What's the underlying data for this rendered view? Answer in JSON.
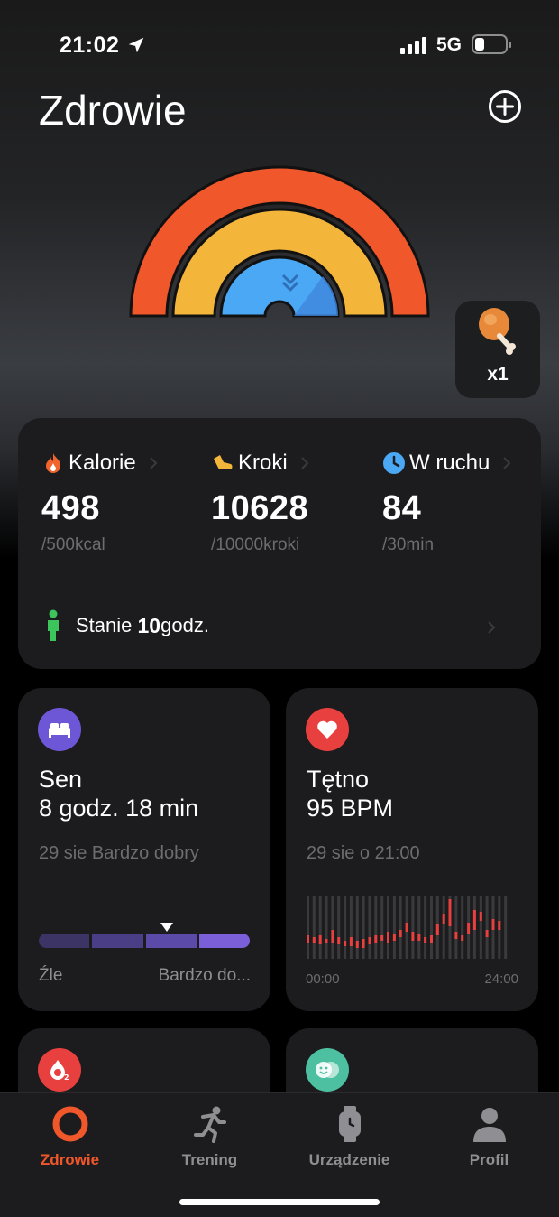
{
  "status_bar": {
    "time": "21:02",
    "network": "5G"
  },
  "header": {
    "title": "Zdrowie"
  },
  "food_badge": {
    "count": "x1"
  },
  "activity": {
    "metrics": [
      {
        "label": "Kalorie",
        "value": "498",
        "goal": "/500kcal",
        "icon": "flame-icon",
        "color": "#f0652d"
      },
      {
        "label": "Kroki",
        "value": "10628",
        "goal": "/10000kroki",
        "icon": "shoe-icon",
        "color": "#f4b63a"
      },
      {
        "label": "W ruchu",
        "value": "84",
        "goal": "/30min",
        "icon": "clock-icon",
        "color": "#4aa8f4"
      }
    ],
    "stand": {
      "label": "Stanie",
      "value": "10",
      "unit": "godz."
    }
  },
  "sleep": {
    "title": "Sen",
    "value": "8 godz. 18 min",
    "detail": "29 sie Bardzo dobry",
    "scale_low": "Źle",
    "scale_high": "Bardzo do...",
    "level_segment": 3,
    "segments": 4,
    "colors": [
      "#3b3464",
      "#4a3f86",
      "#5b4aa8",
      "#7b5fd8"
    ]
  },
  "heart": {
    "title": "Tętno",
    "value": "95 BPM",
    "detail": "29 sie o 21:00",
    "axis_start": "00:00",
    "axis_end": "24:00"
  },
  "colors": {
    "accent": "#f0572a",
    "outer_ring": "#f0572a",
    "middle_ring": "#f4b63a",
    "inner_ring": "#4aa8f4",
    "sleep_icon_bg": "#6e57d6",
    "heart_icon_bg": "#e8403f",
    "spo2_icon_bg": "#e8403f",
    "stress_icon_bg": "#4cc0a0"
  },
  "tabs": [
    {
      "label": "Zdrowie",
      "icon": "ring-icon",
      "active": true
    },
    {
      "label": "Trening",
      "icon": "runner-icon",
      "active": false
    },
    {
      "label": "Urządzenie",
      "icon": "watch-icon",
      "active": false
    },
    {
      "label": "Profil",
      "icon": "person-icon",
      "active": false
    }
  ]
}
